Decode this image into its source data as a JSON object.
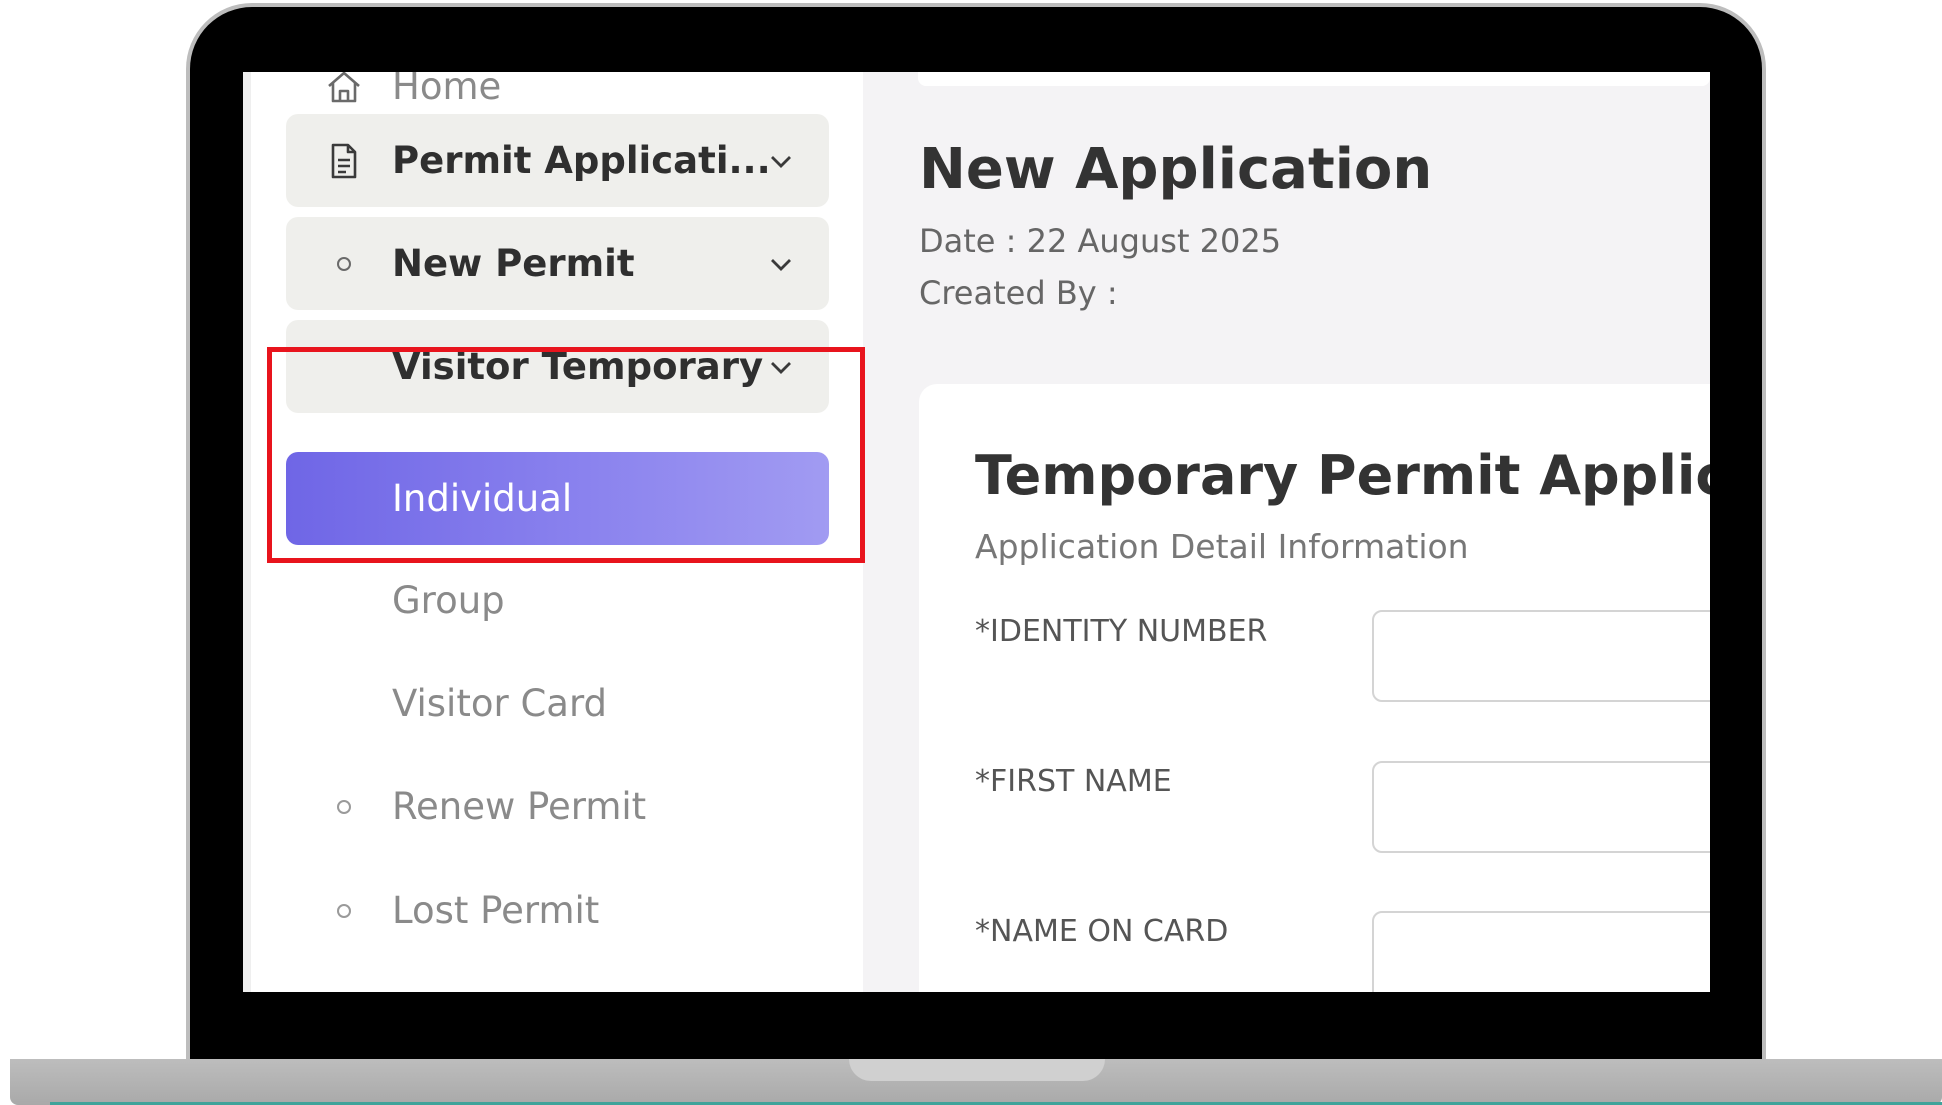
{
  "sidebar": {
    "items": [
      {
        "label": "Home",
        "icon": "home-icon"
      },
      {
        "label": "Permit Applicati...",
        "icon": "document-icon"
      },
      {
        "label": "New Permit",
        "icon": "bullet-icon"
      },
      {
        "label": "Visitor Temporary"
      },
      {
        "label": "Individual"
      },
      {
        "label": "Group"
      },
      {
        "label": "Visitor Card"
      },
      {
        "label": "Renew Permit",
        "icon": "bullet-icon"
      },
      {
        "label": "Lost Permit",
        "icon": "bullet-icon"
      }
    ]
  },
  "header": {
    "title": "New Application",
    "date_line": "Date : 22 August 2025",
    "created_by_line": "Created By :"
  },
  "form": {
    "title": "Temporary Permit Application",
    "subtitle": "Application Detail Information",
    "fields": [
      {
        "label": "*IDENTITY NUMBER",
        "value": ""
      },
      {
        "label": "*FIRST NAME",
        "value": ""
      },
      {
        "label": "*NAME ON CARD",
        "value": ""
      }
    ]
  },
  "colors": {
    "accent": "#7068e8",
    "highlight": "#e8141d"
  }
}
